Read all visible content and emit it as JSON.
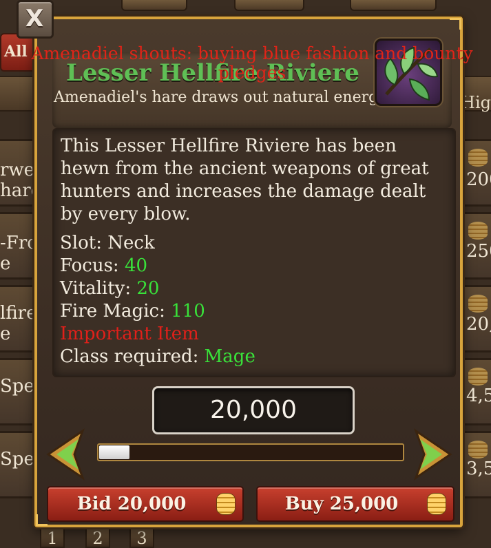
{
  "background": {
    "tab_all": "All",
    "header_high": "Hig",
    "rows": [
      {
        "left": "rwel\nharc",
        "right": "200"
      },
      {
        "left": "-Fro\ne",
        "right": "250"
      },
      {
        "left": "lfire\ne",
        "right": "20,"
      },
      {
        "left": "Spel",
        "right": "4,5"
      },
      {
        "left": "Spel",
        "right": "3,5"
      }
    ],
    "pages": [
      "1",
      "2",
      "3"
    ]
  },
  "close_label": "X",
  "chat_shout": "Amenadiel shouts: buying blue fashion and bounty pledges",
  "item": {
    "name": "Lesser Hellfire Riviere",
    "subtitle": "Amenadiel's hare draws out natural energy.",
    "icon": "leaf-icon",
    "description": "This Lesser Hellfire Riviere has been hewn from the ancient weapons of great hunters and increases the damage dealt by every blow.",
    "stats": {
      "slot_label": "Slot:",
      "slot_value": "Neck",
      "focus_label": "Focus:",
      "focus_value": "40",
      "vitality_label": "Vitality:",
      "vitality_value": "20",
      "fire_label": "Fire Magic:",
      "fire_value": "110",
      "important": "Important Item",
      "class_label": "Class required:",
      "class_value": "Mage"
    }
  },
  "bid": {
    "amount_display": "20,000",
    "slider_fraction": 0.1,
    "bid_button": "Bid 20,000",
    "buy_button": "Buy 25,000"
  },
  "colors": {
    "accent_gold": "#d8a43c",
    "stat_green": "#39e23a",
    "warning_red": "#e0201a"
  }
}
